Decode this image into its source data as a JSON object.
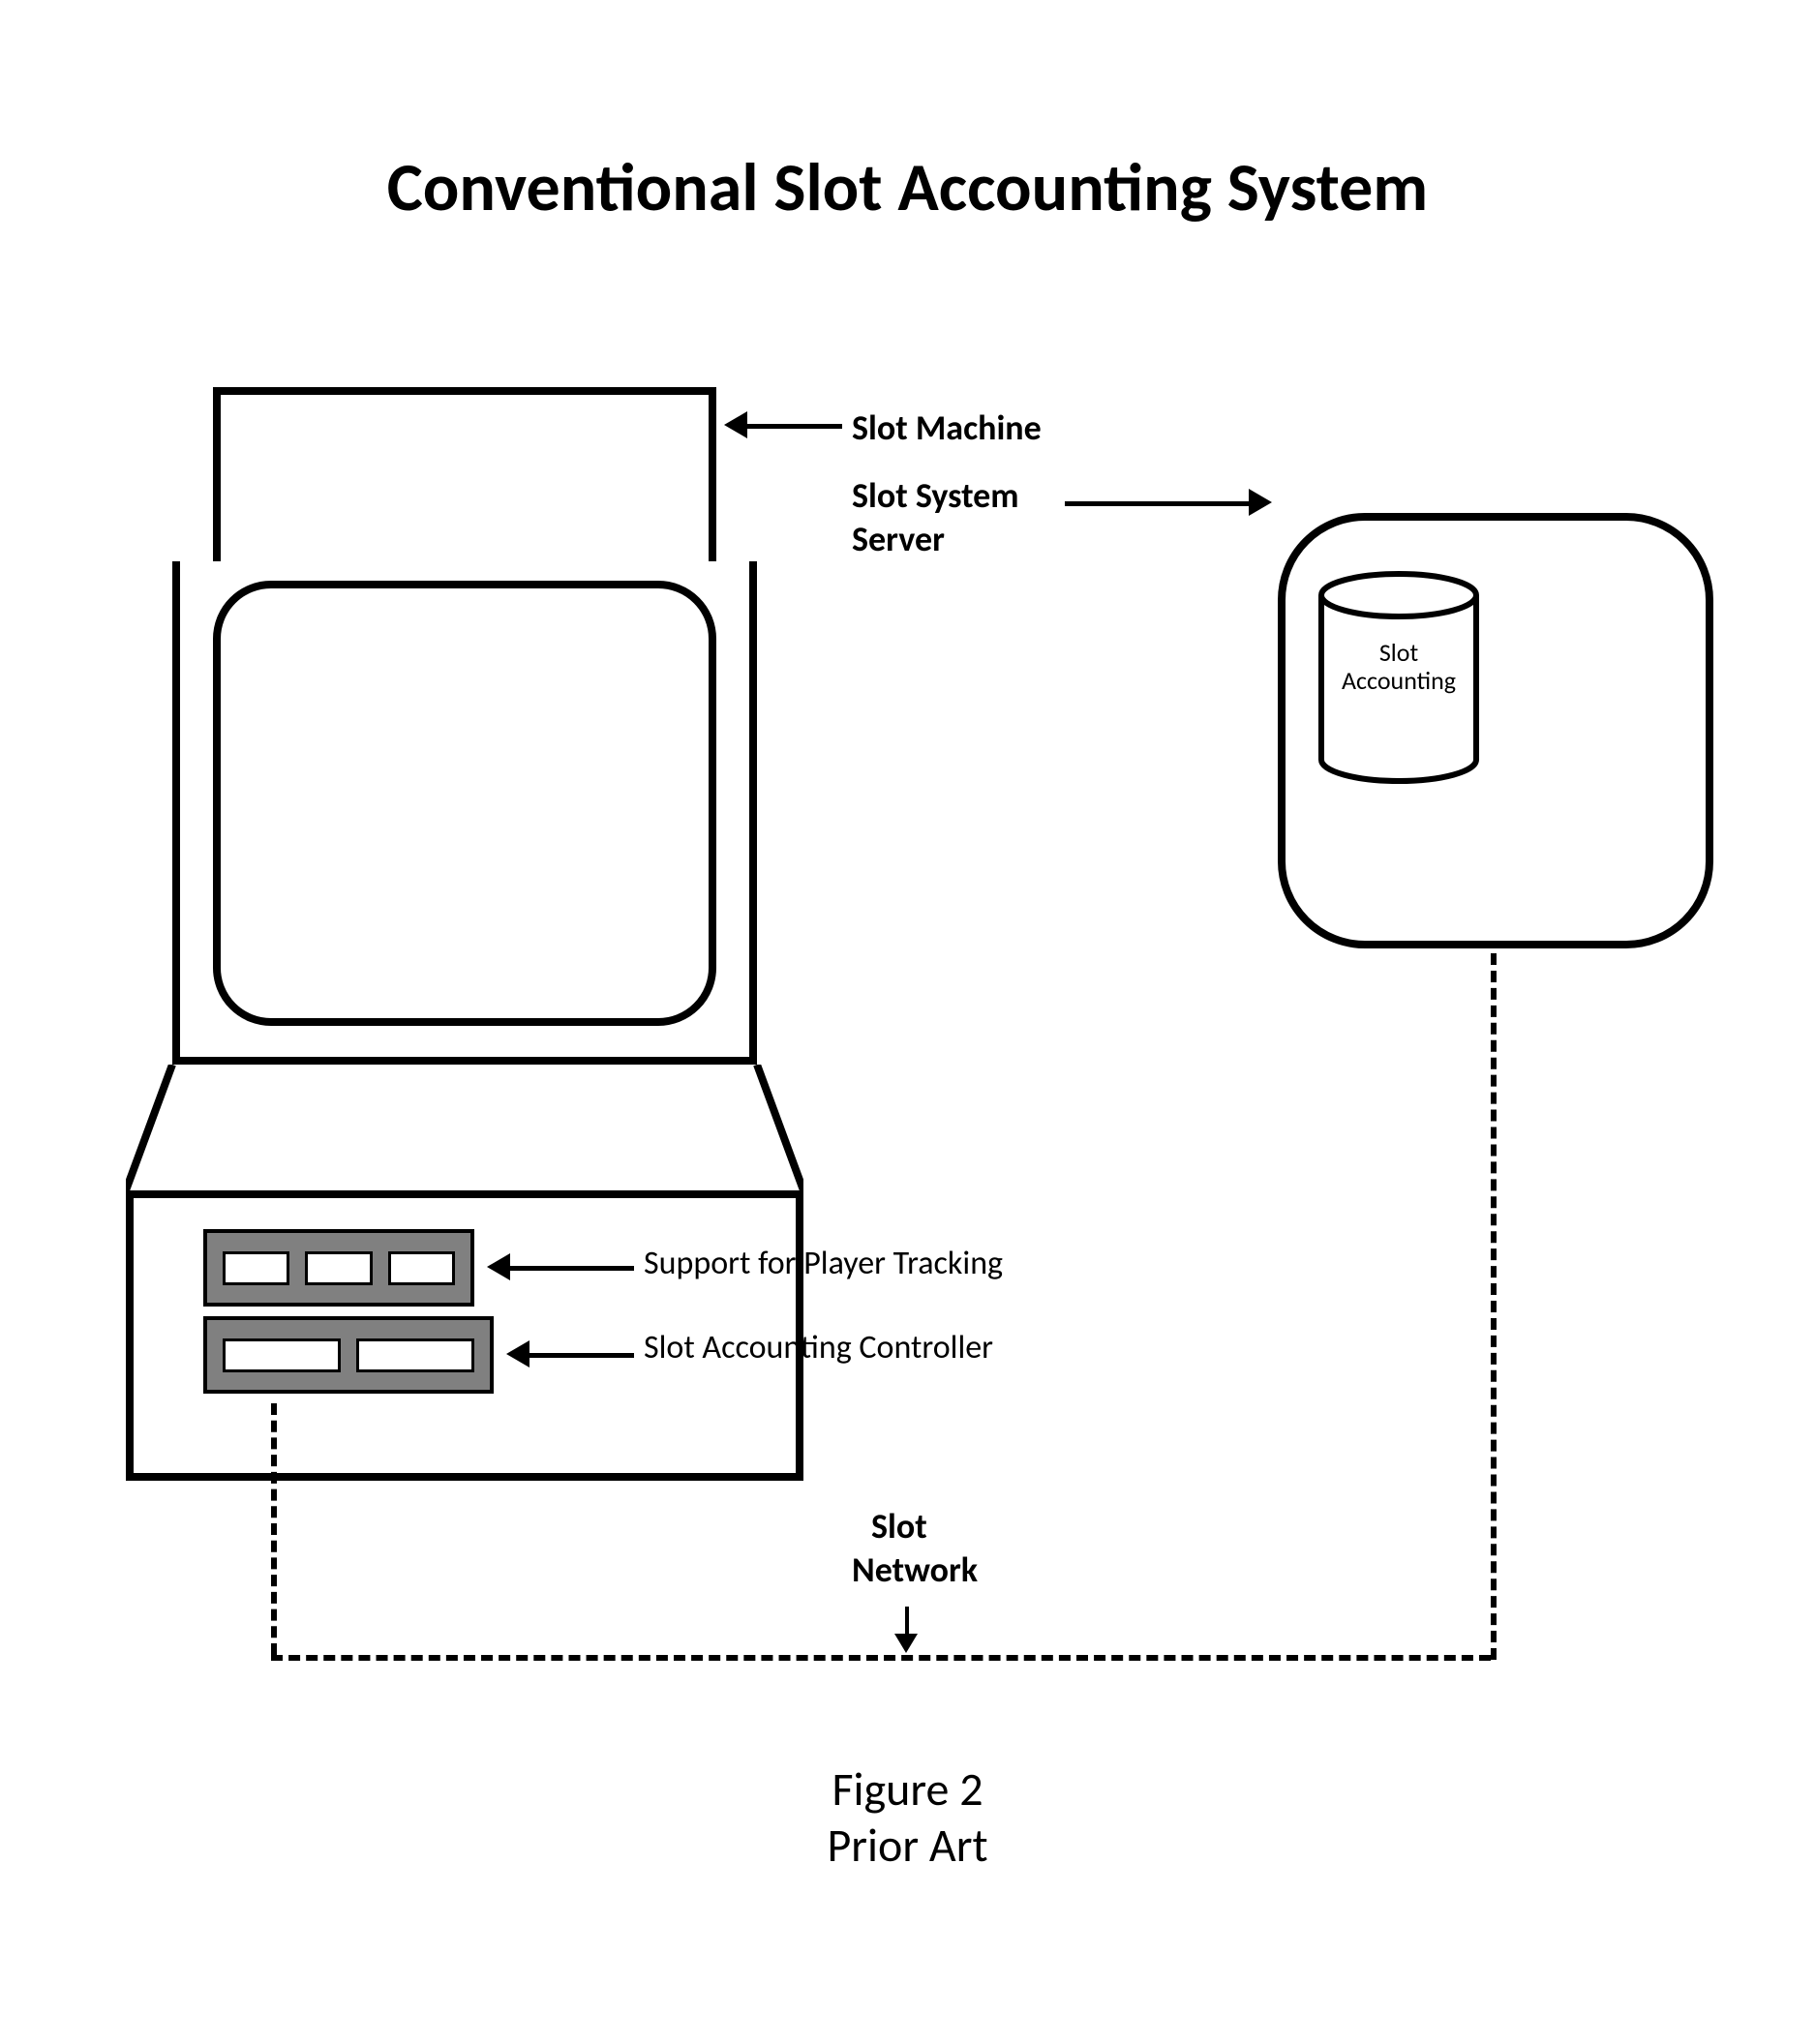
{
  "title": "Conventional Slot Accounting System",
  "figure": {
    "line1": "Figure 2",
    "line2": "Prior Art"
  },
  "labels": {
    "slot_machine": "Slot Machine",
    "server1": "Slot System",
    "server2": "Server",
    "player_tracking": "Support for Player Tracking",
    "slot_accounting_controller": "Slot Accounting Controller",
    "network1": "Slot",
    "network2": "Network"
  },
  "db": {
    "line1": "Slot",
    "line2": "Accounting"
  }
}
